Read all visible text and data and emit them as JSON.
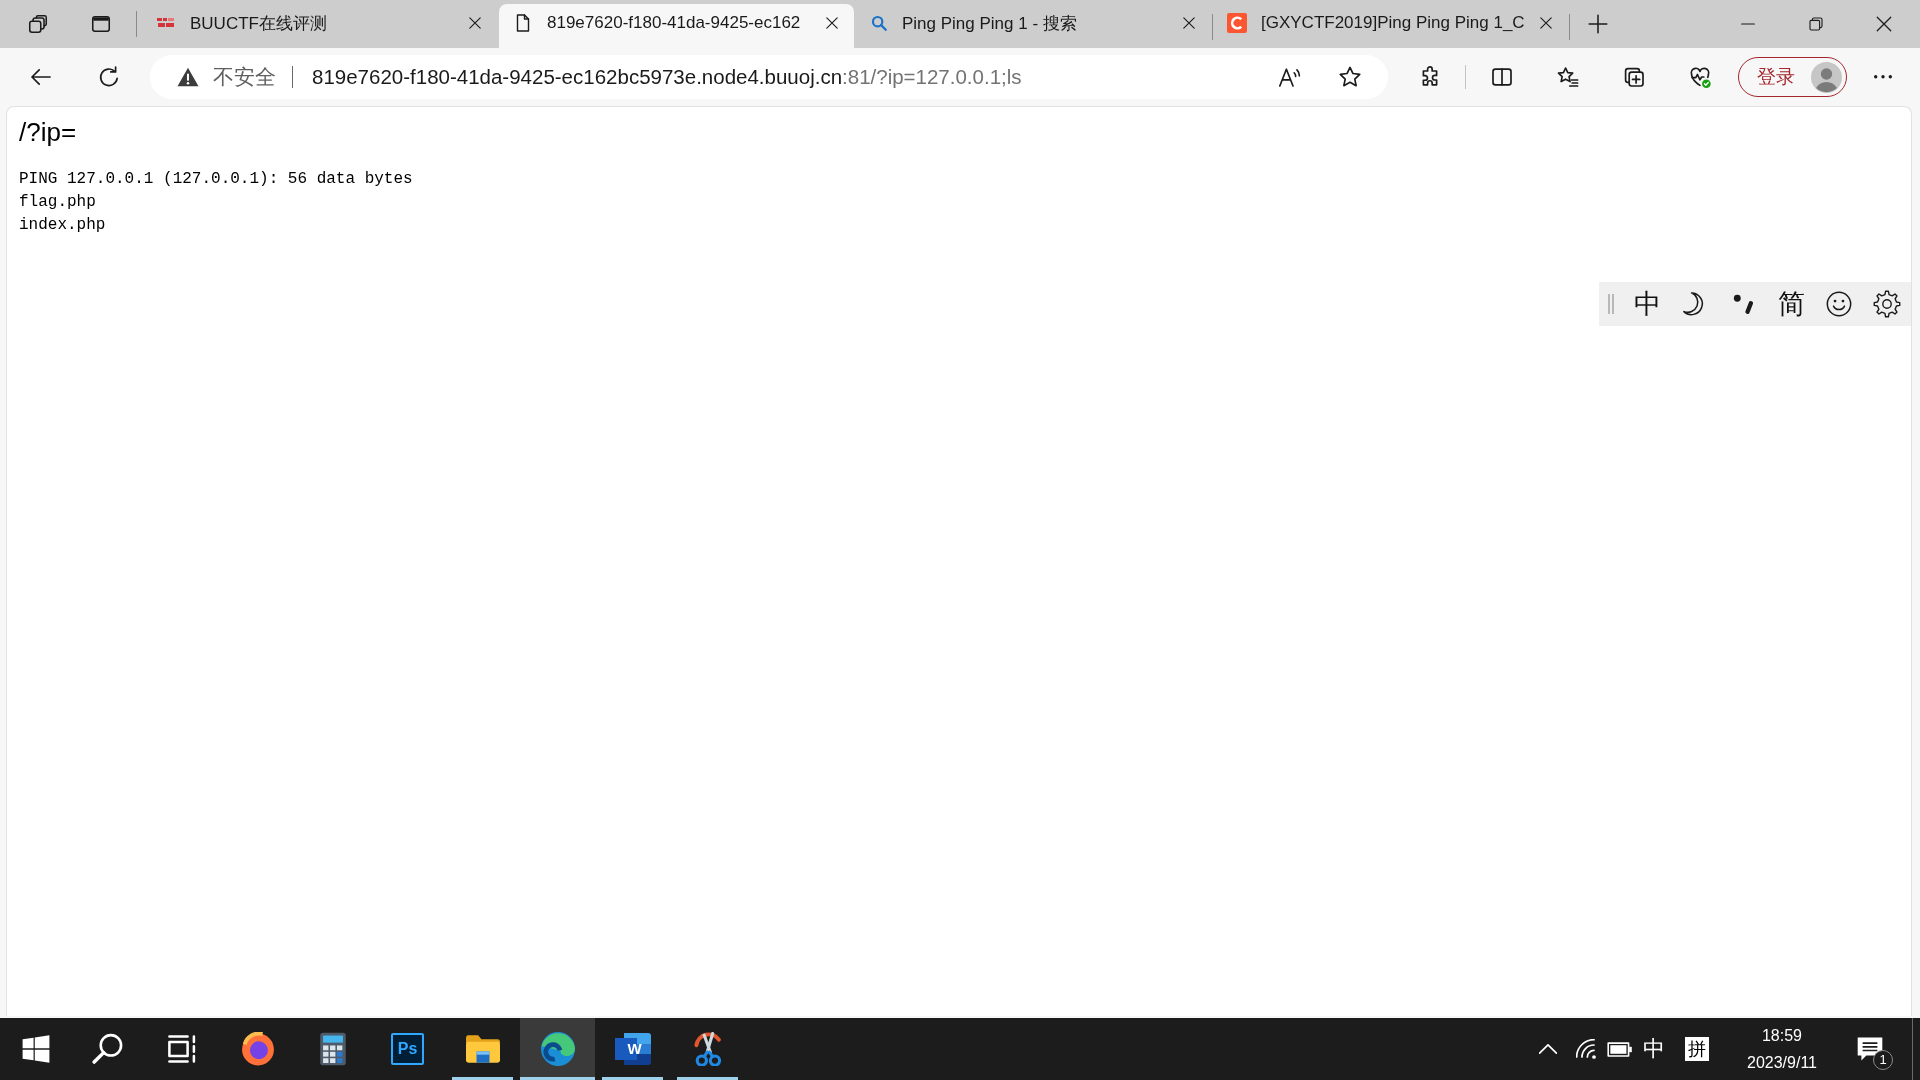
{
  "tabbar": {
    "tabs": [
      {
        "kind": "logo",
        "title": "BUUCTF在线评测",
        "selected": false
      },
      {
        "kind": "page",
        "title": "819e7620-f180-41da-9425-ec162",
        "selected": true
      },
      {
        "kind": "search",
        "title": "Ping Ping Ping 1 - 搜索",
        "selected": false
      },
      {
        "kind": "badge",
        "title": "[GXYCTF2019]Ping Ping Ping 1_C",
        "selected": false
      }
    ]
  },
  "address_bar": {
    "security_label": "不安全",
    "host": "819e7620-f180-41da-9425-ec162bc5973e.node4.buuoj.cn",
    "path": ":81/?ip=127.0.0.1;ls"
  },
  "profile_button": {
    "label": "登录"
  },
  "page": {
    "heading": "/?ip=",
    "output": [
      "PING 127.0.0.1 (127.0.0.1): 56 data bytes",
      "flag.php",
      "index.php"
    ]
  },
  "ime_toolbar": {
    "mode": "中",
    "charset": "简"
  },
  "taskbar": {
    "items": [
      {
        "kind": "start",
        "running": false,
        "selected": false
      },
      {
        "kind": "search",
        "running": false,
        "selected": false
      },
      {
        "kind": "taskview",
        "running": false,
        "selected": false
      },
      {
        "kind": "fox",
        "running": false,
        "selected": false
      },
      {
        "kind": "calculator",
        "running": false,
        "selected": false
      },
      {
        "kind": "imageeditor",
        "label": "Ps",
        "running": false,
        "selected": false
      },
      {
        "kind": "folder",
        "running": true,
        "selected": false
      },
      {
        "kind": "swirl",
        "running": true,
        "selected": true
      },
      {
        "kind": "wordprocessor",
        "label": "W",
        "running": true,
        "selected": false
      },
      {
        "kind": "snipping",
        "running": true,
        "selected": false
      }
    ]
  },
  "tray": {
    "input_language": "中",
    "ime_mode": "拼",
    "time": "18:59",
    "date": "2023/9/11",
    "notification_count": "1"
  }
}
